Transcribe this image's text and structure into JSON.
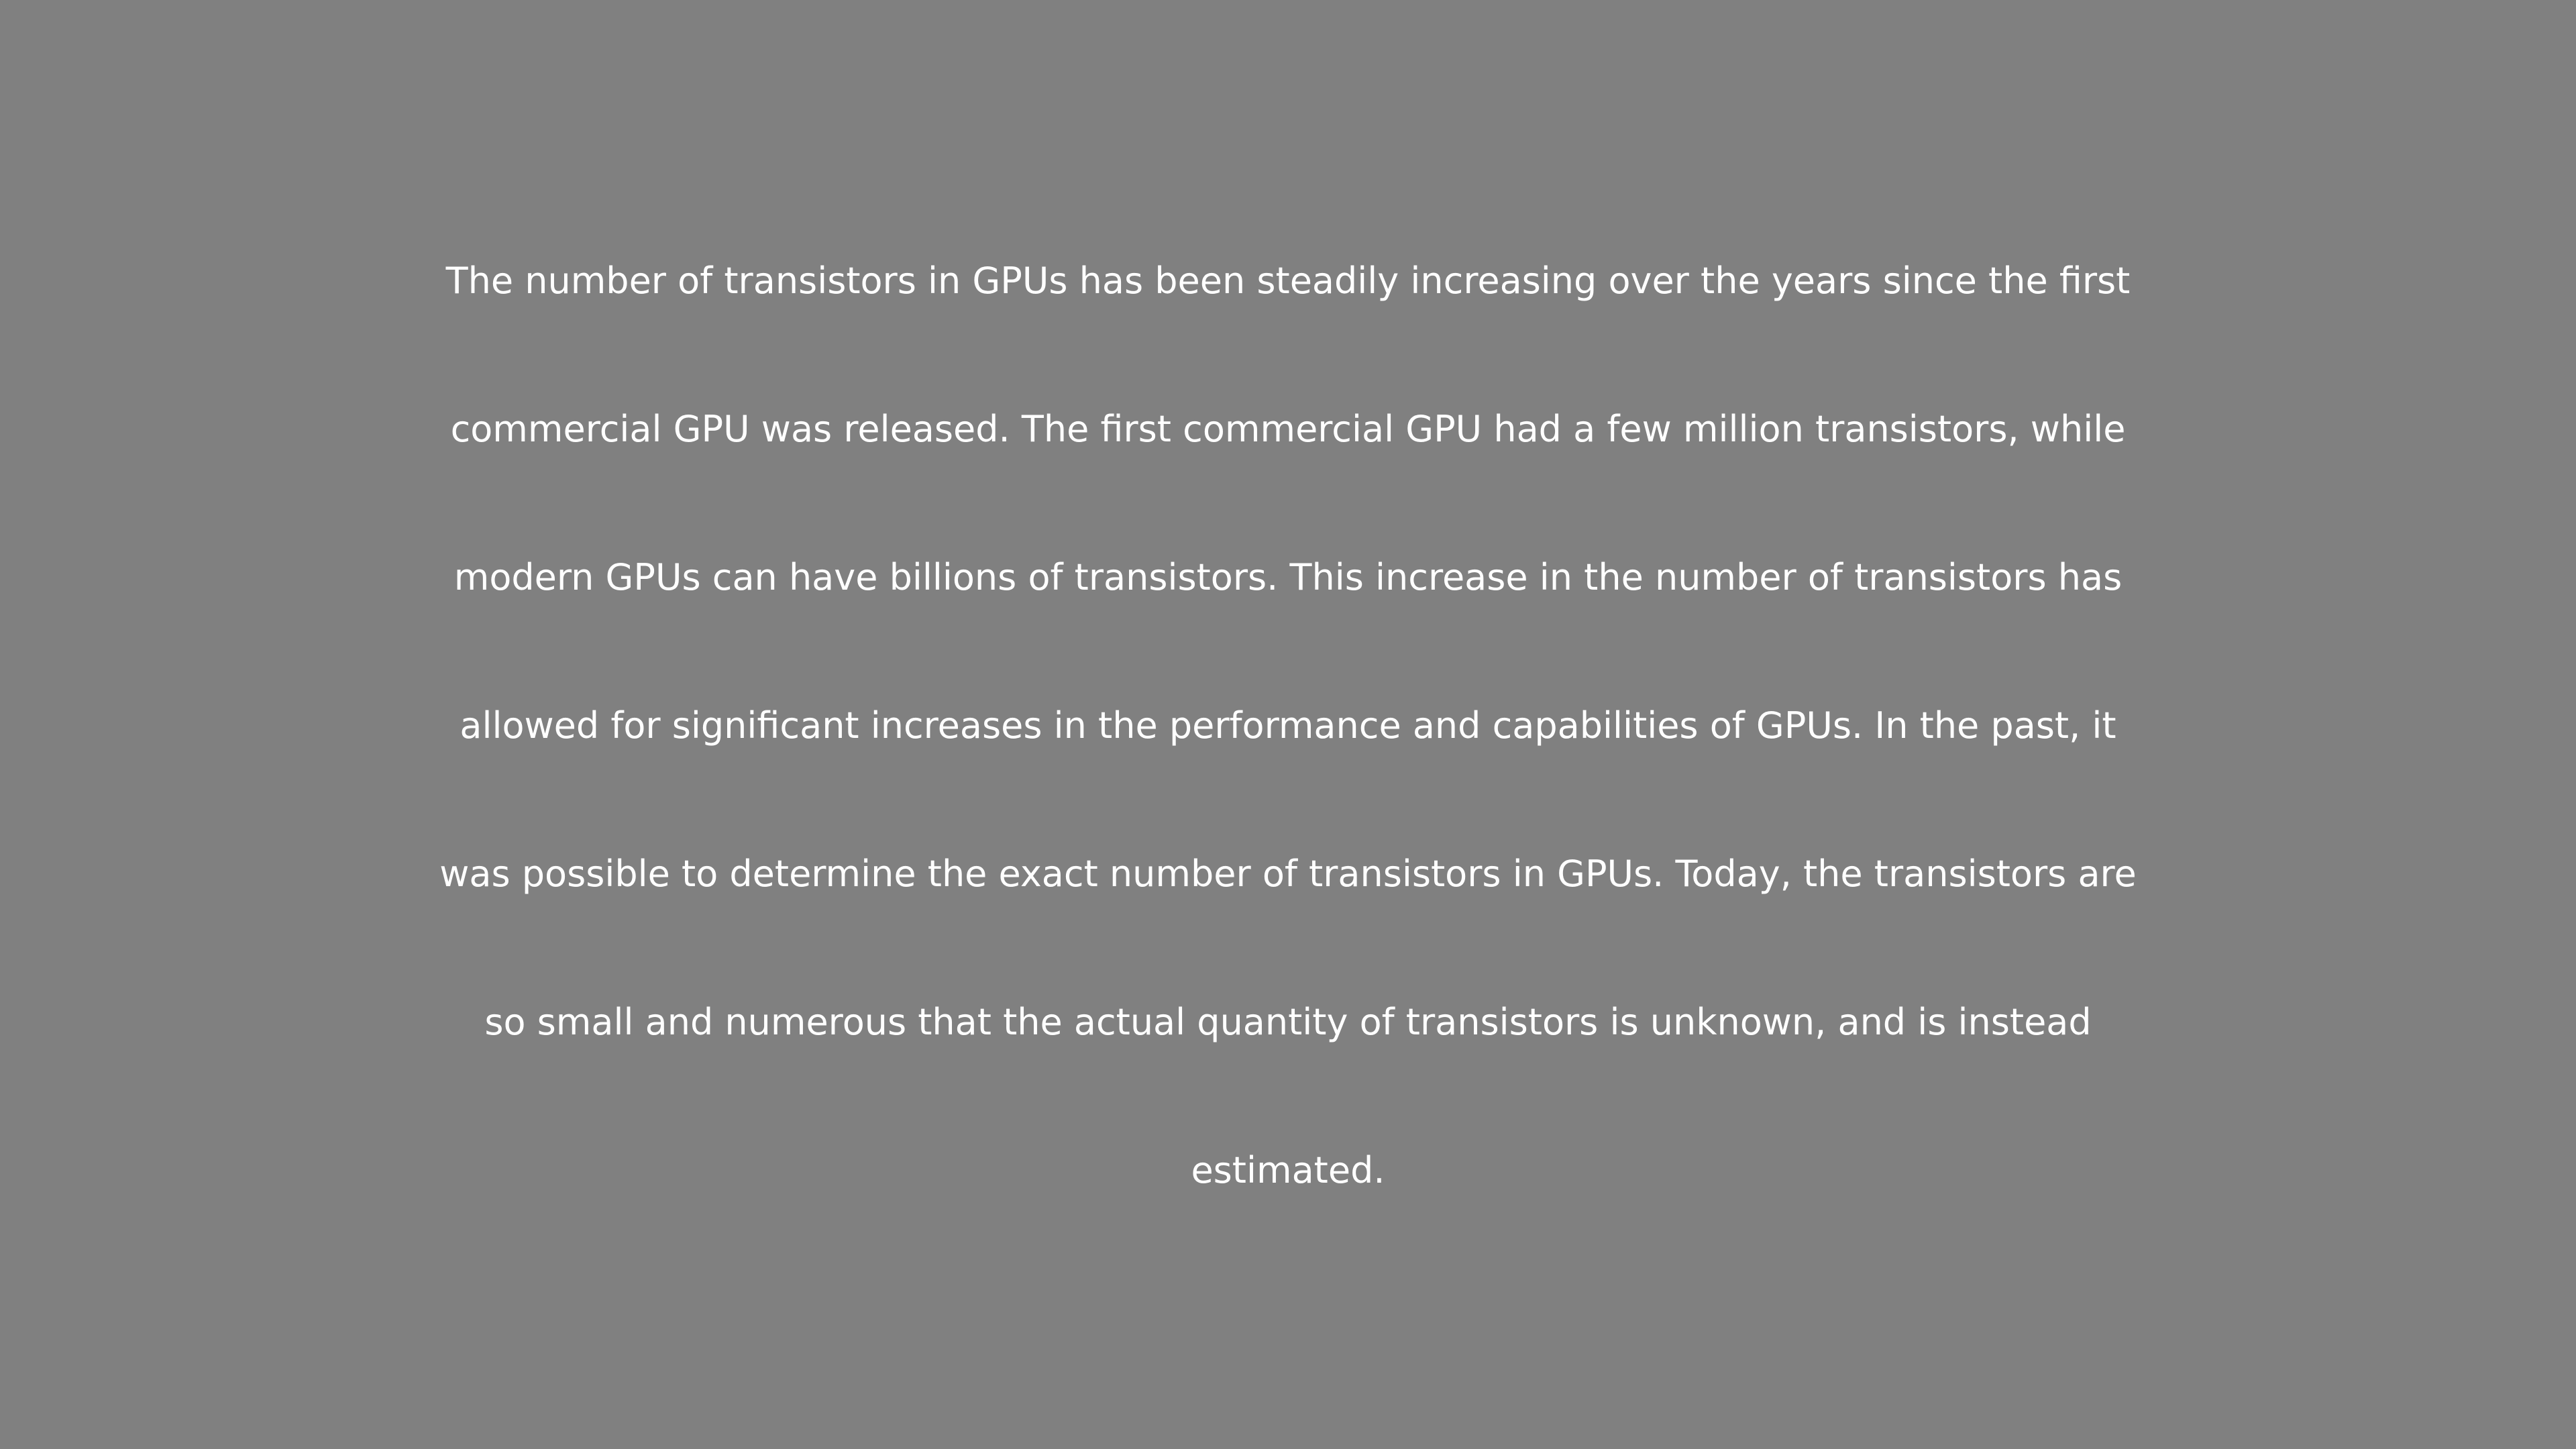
{
  "document": {
    "background_color": "#808080",
    "text_color": "#ffffff",
    "lines": [
      "The number of transistors in GPUs has been steadily increasing over the years since the first",
      "commercial GPU was released. The first commercial GPU had a few million transistors, while",
      "modern GPUs can have billions of transistors. This increase in the number of transistors has",
      "allowed for significant increases in the performance and capabilities of GPUs. In the past, it",
      "was possible to determine the exact number of transistors in GPUs. Today, the transistors are",
      "so small and numerous that the actual quantity of transistors is unknown, and is instead",
      "estimated."
    ]
  }
}
